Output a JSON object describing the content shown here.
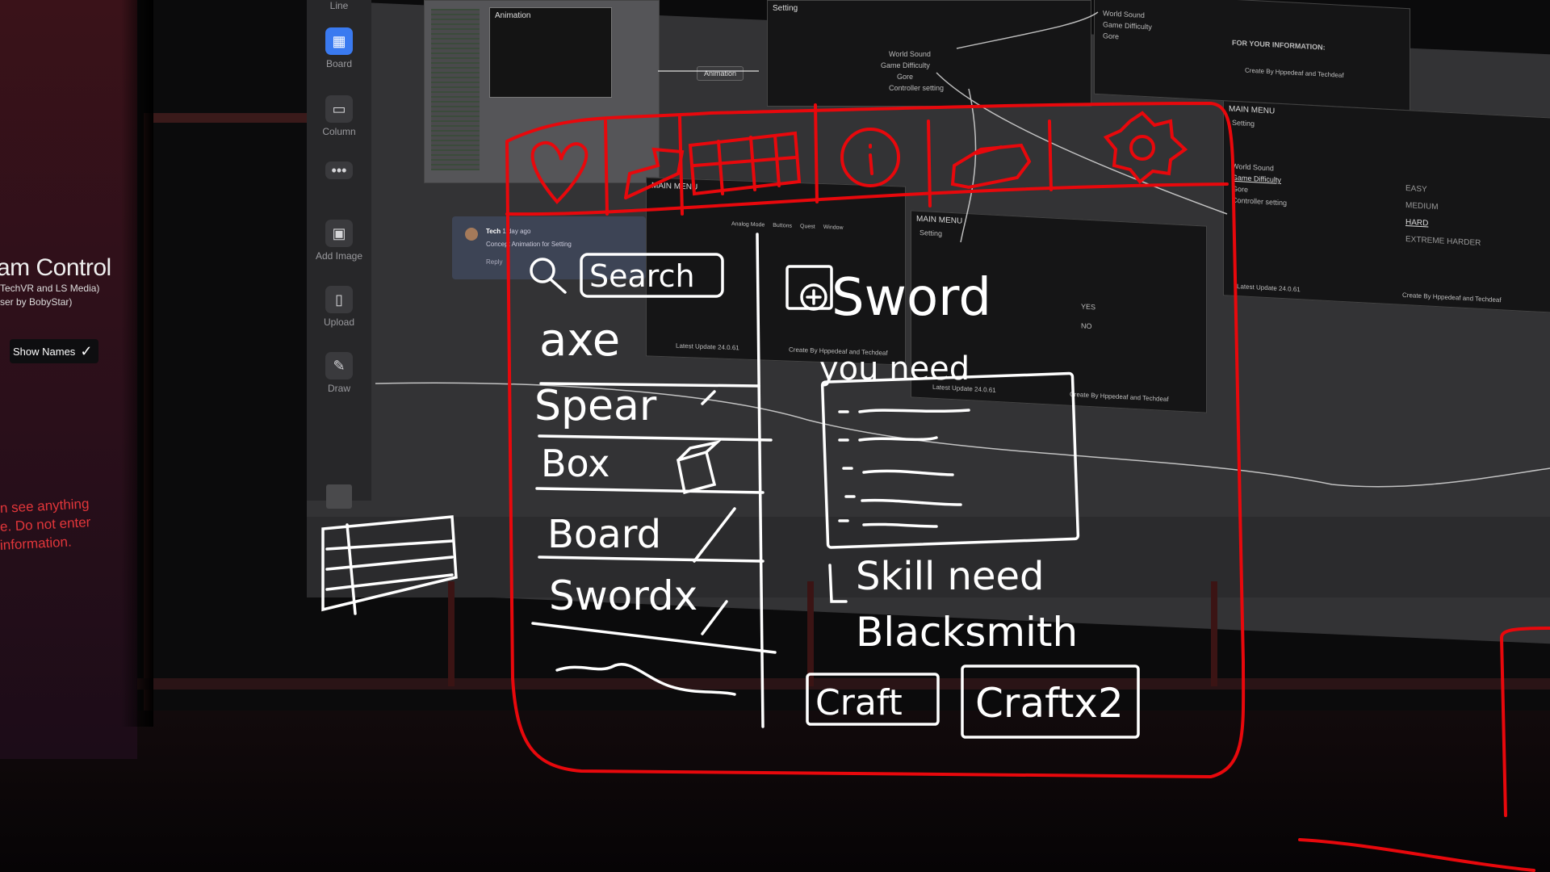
{
  "left_panel": {
    "title": "am Control",
    "credits_line1": "TechVR and LS Media)",
    "credits_line2": "ser by BobyStar)",
    "show_names_label": "Show Names",
    "show_names_checked": true,
    "warning_lines": [
      "n see anything",
      "e. Do not enter",
      "information."
    ]
  },
  "toolbar": {
    "items": [
      {
        "label": "Line",
        "icon": "line-icon"
      },
      {
        "label": "Board",
        "icon": "board-icon",
        "active": true
      },
      {
        "label": "Column",
        "icon": "column-icon"
      },
      {
        "label": "",
        "icon": "more-icon"
      },
      {
        "label": "Add Image",
        "icon": "image-icon"
      },
      {
        "label": "Upload",
        "icon": "file-icon"
      },
      {
        "label": "Draw",
        "icon": "pencil-icon"
      }
    ]
  },
  "board_cards": {
    "animation_label": "Animation",
    "editor_tab": "Animation",
    "setting_title": "Setting",
    "main_menu": "MAIN MENU",
    "setting_items": [
      "World Sound",
      "Game Difficulty",
      "Gore",
      "Controller setting"
    ],
    "difficulty_items": [
      "EASY",
      "MEDIUM",
      "HARD",
      "EXTREME HARDER"
    ],
    "yes_no": [
      "YES",
      "NO"
    ],
    "footer_left": "Latest Update 24.0.61",
    "footer_right": "Create By Hppedeaf and Techdeaf",
    "info_heading": "FOR YOUR INFORMATION:",
    "comment_author": "Tech",
    "comment_time": "1 day ago",
    "comment_text": "Concept Animation for Setting",
    "comment_reply": "Reply",
    "controls_row": [
      "Analog Mode",
      "Buttons",
      "Quest",
      "Window"
    ]
  },
  "sketch": {
    "search": "Search",
    "items": [
      "axe",
      "Spear",
      "Box",
      "Board",
      "Swordx"
    ],
    "detail_title": "Sword",
    "you_need": "you need",
    "skill_need": "Skill need",
    "skill": "Blacksmith",
    "craft": "Craft",
    "craft_x2": "Craftx2"
  },
  "colors": {
    "ink_red": "#e8080c",
    "ink_white": "#ffffff",
    "board": "#333335",
    "accent_blue": "#3a7af0"
  }
}
